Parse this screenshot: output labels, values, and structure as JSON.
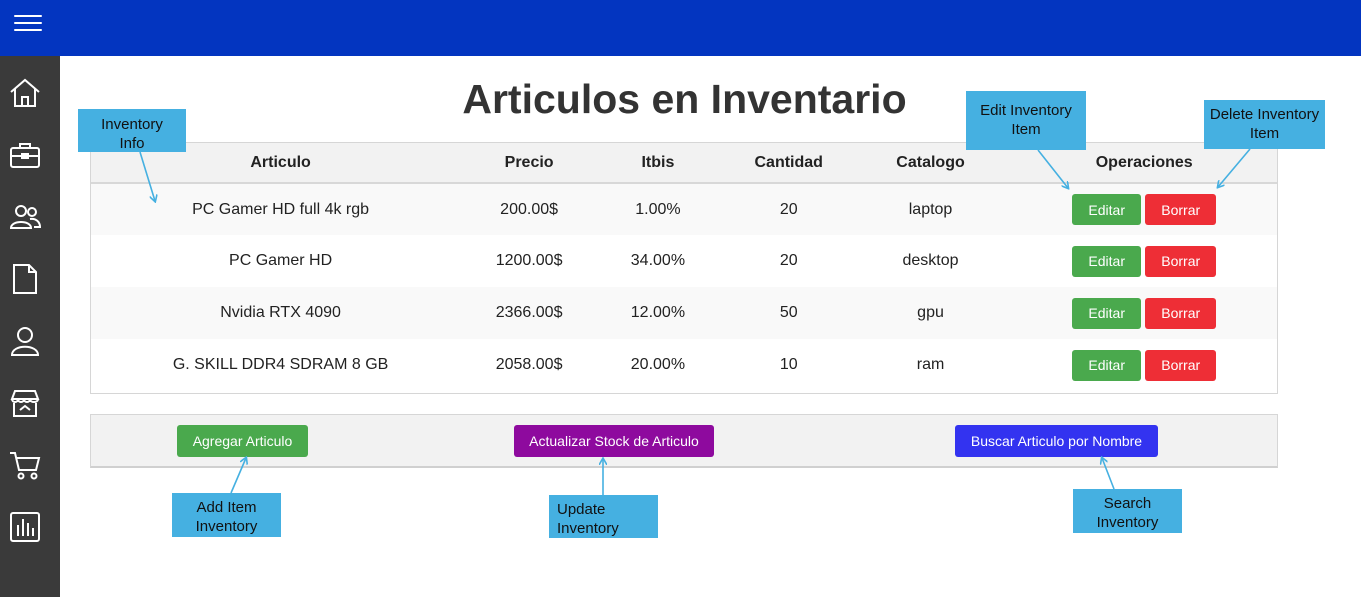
{
  "topbar": {
    "menu_icon": "hamburger-menu-icon",
    "color": "#0335c0"
  },
  "sidebar": {
    "items": [
      {
        "icon": "home-icon"
      },
      {
        "icon": "briefcase-icon"
      },
      {
        "icon": "users-icon"
      },
      {
        "icon": "document-icon"
      },
      {
        "icon": "user-icon"
      },
      {
        "icon": "store-icon"
      },
      {
        "icon": "cart-icon"
      },
      {
        "icon": "bar-chart-icon"
      }
    ]
  },
  "page": {
    "title": "Articulos en Inventario"
  },
  "table": {
    "headers": [
      "Articulo",
      "Precio",
      "Itbis",
      "Cantidad",
      "Catalogo",
      "Operaciones"
    ],
    "rows": [
      {
        "articulo": "PC Gamer HD full 4k rgb",
        "precio": "200.00$",
        "itbis": "1.00%",
        "cantidad": "20",
        "catalogo": "laptop"
      },
      {
        "articulo": "PC Gamer HD",
        "precio": "1200.00$",
        "itbis": "34.00%",
        "cantidad": "20",
        "catalogo": "desktop"
      },
      {
        "articulo": "Nvidia RTX 4090",
        "precio": "2366.00$",
        "itbis": "12.00%",
        "cantidad": "50",
        "catalogo": "gpu"
      },
      {
        "articulo": "G. SKILL DDR4 SDRAM 8 GB",
        "precio": "2058.00$",
        "itbis": "20.00%",
        "cantidad": "10",
        "catalogo": "ram"
      }
    ],
    "edit_label": "Editar",
    "delete_label": "Borrar"
  },
  "toolbar": {
    "add_label": "Agregar Articulo",
    "update_label": "Actualizar Stock de Articulo",
    "search_label": "Buscar Articulo por Nombre"
  },
  "callouts": {
    "inventory_info": "Inventory Info",
    "edit_item": "Edit Inventory Item",
    "delete_item": "Delete Inventory Item",
    "add_item": "Add Item Inventory",
    "update_inventory": "Update Inventory",
    "search_inventory": "Search Inventory"
  },
  "colors": {
    "edit": "#4aa94d",
    "delete": "#ee2e36",
    "add": "#4aa94d",
    "update": "#8e0a9e",
    "search": "#3333f0",
    "callout": "#45b0e1"
  }
}
